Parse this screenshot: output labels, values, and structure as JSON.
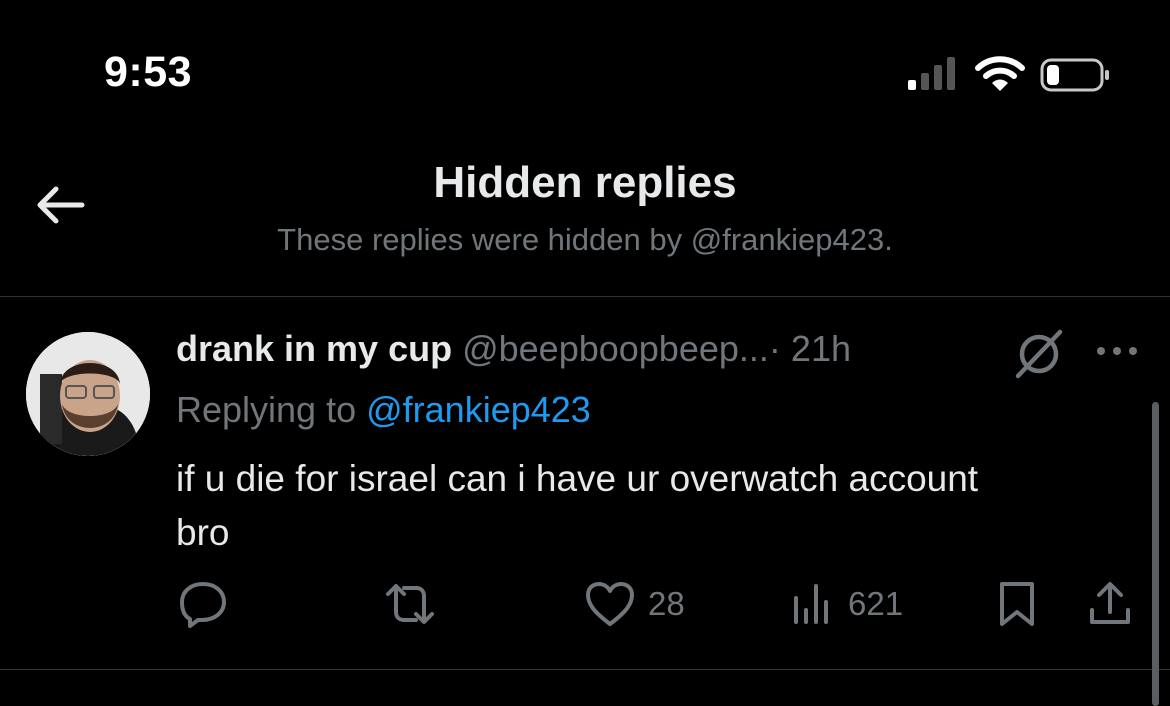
{
  "status_bar": {
    "time": "9:53"
  },
  "header": {
    "title": "Hidden replies",
    "subtitle": "These replies were hidden by @frankiep423."
  },
  "tweet": {
    "display_name": "drank in my cup",
    "handle": "@beepboopbeep...",
    "separator": "·",
    "time_ago": "21h",
    "replying_prefix": "Replying to",
    "replying_to": "@frankiep423",
    "text_line1": "if u die for israel can i have ur overwatch account",
    "text_line2": "bro",
    "actions": {
      "likes": "28",
      "views": "621"
    }
  },
  "icons": {
    "back": "arrow-left-icon",
    "hidden": "hidden-reply-icon",
    "more": "more-horizontal-icon",
    "reply": "comment-icon",
    "retweet": "retweet-icon",
    "like": "heart-icon",
    "views": "views-chart-icon",
    "bookmark": "bookmark-icon",
    "share": "share-icon"
  },
  "colors": {
    "background": "#000000",
    "primary_text": "#e7e9ea",
    "secondary_text": "#71767b",
    "accent": "#1d9bf0",
    "divider": "#2f3336"
  }
}
